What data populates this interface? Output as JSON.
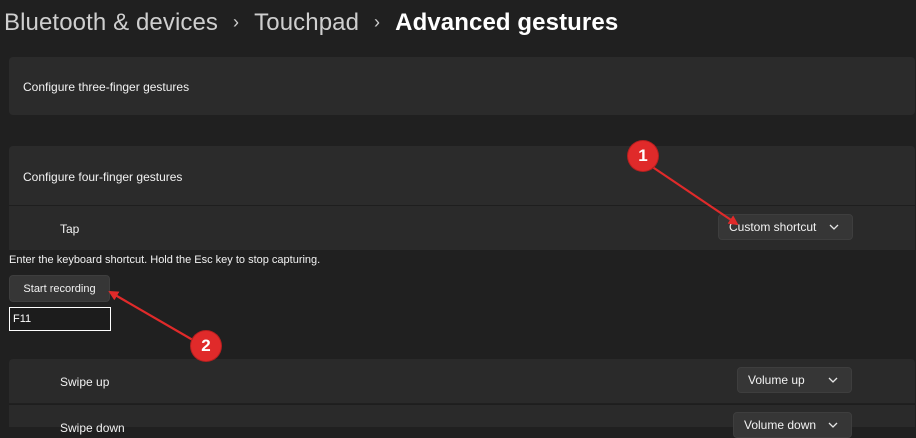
{
  "breadcrumb": {
    "items": [
      "Bluetooth & devices",
      "Touchpad",
      "Advanced gestures"
    ],
    "separator": "›"
  },
  "three_finger": {
    "label": "Configure three-finger gestures"
  },
  "four_finger": {
    "label": "Configure four-finger gestures",
    "tap": {
      "label": "Tap",
      "value": "Custom shortcut"
    },
    "instruction": "Enter the keyboard shortcut. Hold the Esc key to stop capturing.",
    "record_button": "Start recording",
    "shortcut_value": "F11",
    "swipe_up": {
      "label": "Swipe up",
      "value": "Volume up"
    },
    "swipe_down": {
      "label": "Swipe down",
      "value": "Volume down"
    }
  },
  "annotations": {
    "badge_1": "1",
    "badge_2": "2",
    "color": "#e02a2a"
  },
  "colors": {
    "background": "#202020",
    "card": "#2b2b2b",
    "control": "#363636",
    "text": "#ffffff"
  }
}
